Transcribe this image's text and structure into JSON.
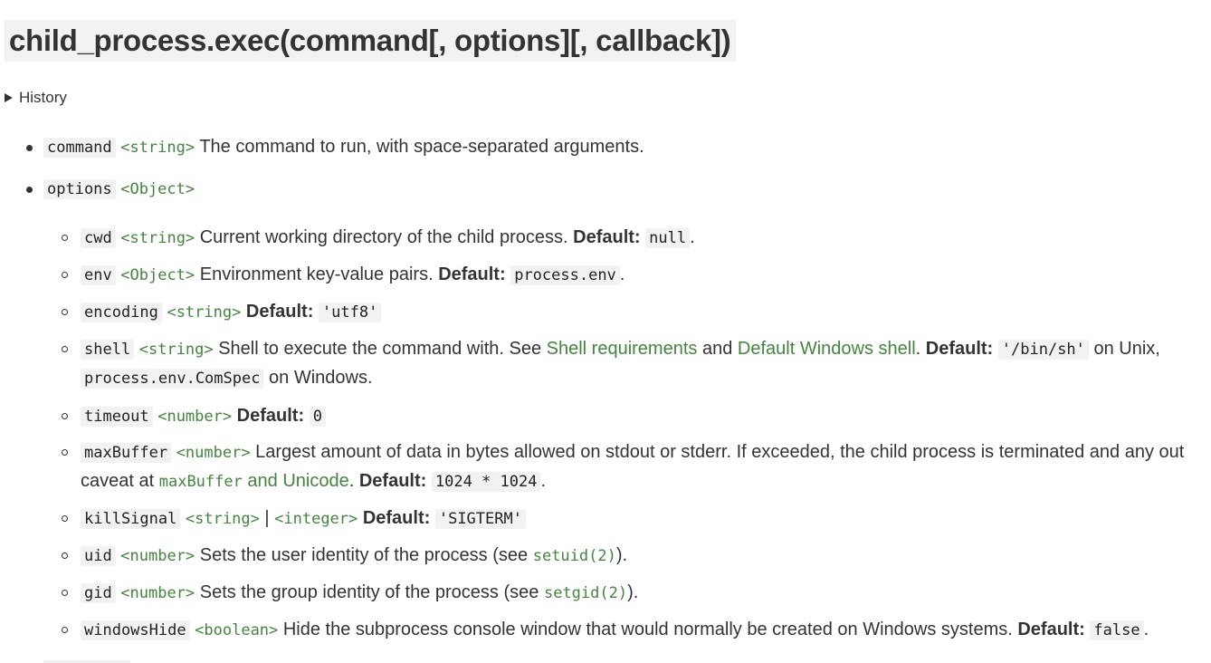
{
  "title": "child_process.exec(command[, options][, callback])",
  "history_label": "History",
  "default_label": "Default:",
  "params": {
    "command": {
      "name": "command",
      "type": "<string>",
      "desc": "The command to run, with space-separated arguments."
    },
    "options": {
      "name": "options",
      "type": "<Object>"
    }
  },
  "options": {
    "cwd": {
      "name": "cwd",
      "type": "<string>",
      "desc": "Current working directory of the child process.",
      "default": "null",
      "tail": "."
    },
    "env": {
      "name": "env",
      "type": "<Object>",
      "desc": "Environment key-value pairs.",
      "default": "process.env",
      "tail": "."
    },
    "encoding": {
      "name": "encoding",
      "type": "<string>",
      "default": "'utf8'"
    },
    "shell": {
      "name": "shell",
      "type": "<string>",
      "desc": "Shell to execute the command with. See",
      "link1": "Shell requirements",
      "and": "and",
      "link2": "Default Windows shell",
      "dot": ".",
      "default": "'/bin/sh'",
      "after_default": "on Unix,",
      "line2_code": "process.env.ComSpec",
      "line2_text": "on Windows."
    },
    "timeout": {
      "name": "timeout",
      "type": "<number>",
      "default": "0"
    },
    "maxBuffer": {
      "name": "maxBuffer",
      "type": "<number>",
      "desc": "Largest amount of data in bytes allowed on stdout or stderr. If exceeded, the child process is terminated and any out",
      "line2_text": "caveat at",
      "line2_link_code": "maxBuffer",
      "line2_link_text": "and Unicode",
      "dot": ".",
      "default": "1024 * 1024",
      "tail": "."
    },
    "killSignal": {
      "name": "killSignal",
      "type1": "<string>",
      "sep": "|",
      "type2": "<integer>",
      "default": "'SIGTERM'"
    },
    "uid": {
      "name": "uid",
      "type": "<number>",
      "desc": "Sets the user identity of the process (see",
      "link": "setuid(2)",
      "tail": ")."
    },
    "gid": {
      "name": "gid",
      "type": "<number>",
      "desc": "Sets the group identity of the process (see",
      "link": "setgid(2)",
      "tail": ")."
    },
    "windowsHide": {
      "name": "windowsHide",
      "type": "<boolean>",
      "desc": "Hide the subprocess console window that would normally be created on Windows systems.",
      "default": "false",
      "tail": "."
    }
  },
  "colors": {
    "text": "#333333",
    "link": "#43853d",
    "code_bg": "#f2f2f2"
  }
}
